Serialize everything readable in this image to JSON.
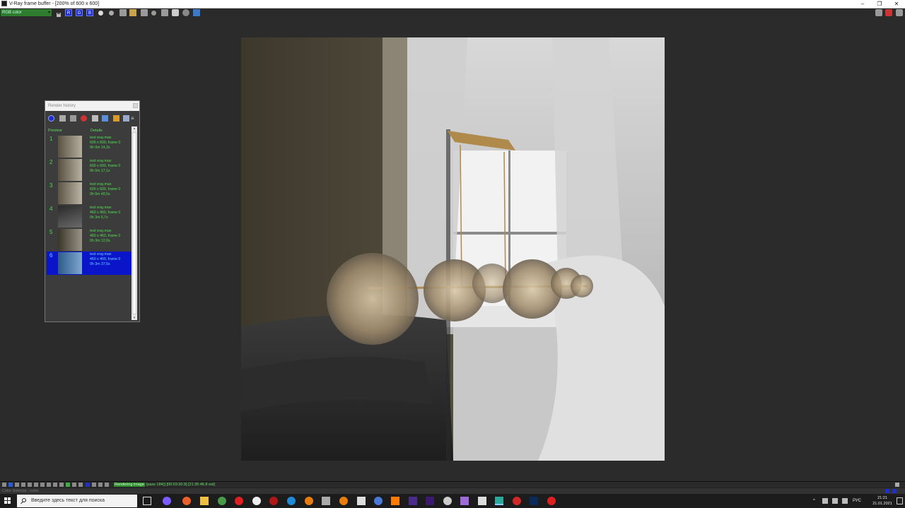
{
  "window": {
    "title": "V-Ray frame buffer - [200% of 600 x 600]",
    "minimize": "–",
    "maximize": "❐",
    "close": "✕"
  },
  "toolbar": {
    "channel": "RGB color",
    "channel_buttons": [
      "R",
      "G",
      "B"
    ]
  },
  "render_history": {
    "title": "Render history",
    "columns": {
      "preview": "Preview",
      "details": "Details"
    },
    "entries": [
      {
        "num": "1",
        "file": "test vray.max",
        "size": "600 x 600, frame 0",
        "time": "0h 0m 14,2s"
      },
      {
        "num": "2",
        "file": "test vray.max",
        "size": "600 x 600, frame 0",
        "time": "0h 0m 17,1s"
      },
      {
        "num": "3",
        "file": "test vray.max",
        "size": "600 x 600, frame 0",
        "time": "0h 0m 49,5s"
      },
      {
        "num": "4",
        "file": "test vray.max",
        "size": "460 x 460, frame 0",
        "time": "0h 3m 5,7s"
      },
      {
        "num": "5",
        "file": "test vray.max",
        "size": "460 x 460, frame 0",
        "time": "0h 3m 12,0s"
      },
      {
        "num": "6",
        "file": "test vray.max",
        "size": "460 x 460, frame 0",
        "time": "0h 3m 37,5s",
        "selected": true
      }
    ]
  },
  "status": {
    "rendering_label": "Rendering image",
    "rendering_detail": "(pass 184)] [00:03:30.9] [21:35:46.8 est]"
  },
  "color_selector": {
    "label": "Color Selector : color"
  },
  "taskbar": {
    "search_placeholder": "Введите здесь текст для поиска",
    "language": "РУС",
    "time": "21:21",
    "date": "21.01.2021",
    "tray_arrow": "^"
  },
  "colors": {
    "accent_green": "#2e7d2e",
    "selected_blue": "#0a14c8",
    "history_text": "#4fe04f"
  }
}
